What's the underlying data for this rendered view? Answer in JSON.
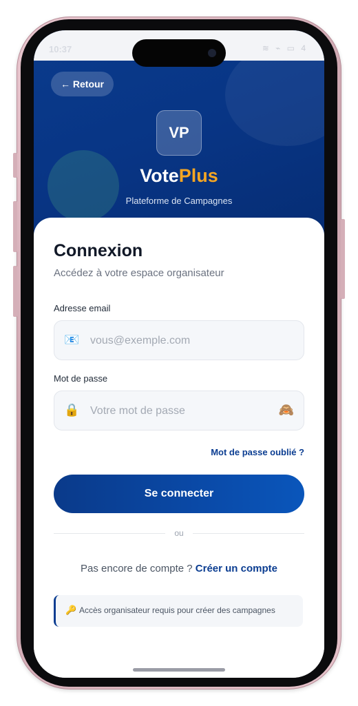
{
  "status_bar": {
    "time": "10:37",
    "icons": "≋ ⌁ ▭ 4"
  },
  "header": {
    "back_label": "← Retour",
    "logo_text": "VP",
    "brand_part1": "Vote",
    "brand_part2": "Plus",
    "tagline": "Plateforme de Campagnes"
  },
  "login": {
    "title": "Connexion",
    "subtitle": "Accédez à votre espace organisateur",
    "email_label": "Adresse email",
    "email_placeholder": "vous@exemple.com",
    "email_value": "",
    "password_label": "Mot de passe",
    "password_placeholder": "Votre mot de passe",
    "password_value": "",
    "forgot_link": "Mot de passe oublié ?",
    "submit_label": "Se connecter",
    "divider_text": "ou",
    "signup_prompt": "Pas encore de compte ?",
    "signup_link": "Créer un compte",
    "notice_text": "Accès organisateur requis pour créer des campagnes"
  },
  "icons": {
    "email": "email-icon",
    "password": "lock-icon",
    "toggle": "monkey-eyes-icon",
    "notice": "key-icon"
  },
  "colors": {
    "primary": "#0b3d91",
    "accent": "#f5a623",
    "hero_bg": "#083585"
  }
}
